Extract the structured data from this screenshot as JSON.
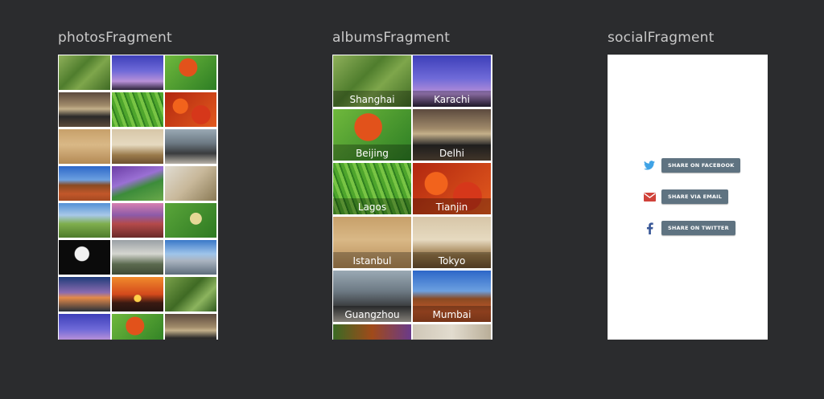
{
  "titles": {
    "photos": "photosFragment",
    "albums": "albumsFragment",
    "social": "socialFragment"
  },
  "photos": [
    {
      "name": "field"
    },
    {
      "name": "hiker"
    },
    {
      "name": "leaf"
    },
    {
      "name": "coast"
    },
    {
      "name": "grass"
    },
    {
      "name": "maple"
    },
    {
      "name": "wheat"
    },
    {
      "name": "desert"
    },
    {
      "name": "city"
    },
    {
      "name": "mesa"
    },
    {
      "name": "purple"
    },
    {
      "name": "wood"
    },
    {
      "name": "hills"
    },
    {
      "name": "sunsetsky"
    },
    {
      "name": "snail"
    },
    {
      "name": "jelly"
    },
    {
      "name": "tree"
    },
    {
      "name": "scope"
    },
    {
      "name": "palm"
    },
    {
      "name": "sunset"
    },
    {
      "name": "field2"
    },
    {
      "name": "hiker"
    },
    {
      "name": "leaf"
    },
    {
      "name": "coast"
    }
  ],
  "albums": [
    {
      "label": "Shanghai",
      "img": "field"
    },
    {
      "label": "Karachi",
      "img": "hiker"
    },
    {
      "label": "Beijing",
      "img": "leaf"
    },
    {
      "label": "Delhi",
      "img": "coast"
    },
    {
      "label": "Lagos",
      "img": "grass"
    },
    {
      "label": "Tianjin",
      "img": "maple"
    },
    {
      "label": "Istanbul",
      "img": "wheat"
    },
    {
      "label": "Tokyo",
      "img": "desert"
    },
    {
      "label": "Guangzhou",
      "img": "city"
    },
    {
      "label": "Mumbai",
      "img": "mesa"
    }
  ],
  "social": {
    "facebook_label": "SHARE ON FACEBOOK",
    "email_label": "SHARE VIA EMAIL",
    "twitter_label": "SHARE ON TWITTER",
    "icons": {
      "facebook_row": "twitter-bird-icon",
      "email_row": "envelope-icon",
      "twitter_row": "facebook-f-icon"
    },
    "colors": {
      "twitter": "#3fa3e6",
      "email": "#d0423a",
      "facebook": "#3b5998",
      "button": "#5f7381"
    }
  }
}
